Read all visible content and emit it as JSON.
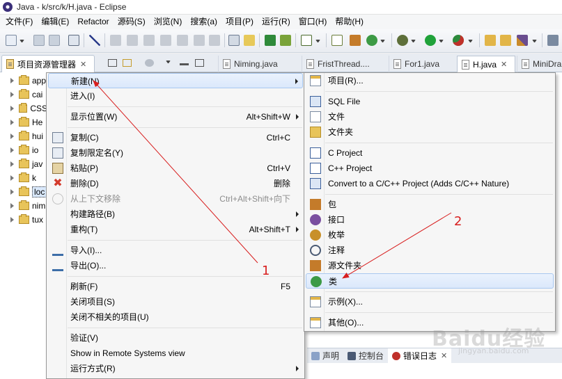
{
  "window": {
    "title": "Java - k/src/k/H.java - Eclipse"
  },
  "menubar": {
    "items": [
      "文件(F)",
      "编辑(E)",
      "Refactor",
      "源码(S)",
      "浏览(N)",
      "搜索(a)",
      "项目(P)",
      "运行(R)",
      "窗口(H)",
      "帮助(H)"
    ]
  },
  "tabs": {
    "explorer": {
      "label": "项目资源管理器",
      "close": "✕"
    },
    "editors": [
      {
        "label": "Niming.java"
      },
      {
        "label": "FristThread...."
      },
      {
        "label": "For1.java"
      },
      {
        "label": "H.java",
        "close": "✕"
      },
      {
        "label": "MiniDra"
      }
    ]
  },
  "explorer": {
    "items": [
      "app",
      "cai",
      "CSS",
      "He",
      "hui",
      "io",
      "jav",
      "k",
      "loc",
      "nim",
      "tux"
    ],
    "selected_index": 8
  },
  "context_menu": {
    "items": [
      {
        "label": "新建(N)",
        "accel": "",
        "submenu": true,
        "highlighted": true
      },
      {
        "label": "进入(I)",
        "accel": ""
      },
      {
        "label": "显示位置(W)",
        "accel": "Alt+Shift+W",
        "submenu": true
      },
      {
        "label": "复制(C)",
        "accel": "Ctrl+C",
        "icon": "copy-icon"
      },
      {
        "label": "复制限定名(Y)",
        "accel": "",
        "icon": "copy-qualified-icon"
      },
      {
        "label": "粘贴(P)",
        "accel": "Ctrl+V",
        "icon": "paste-icon"
      },
      {
        "label": "删除(D)",
        "accel": "删除",
        "icon": "delete-icon"
      },
      {
        "label": "从上下文移除",
        "accel": "Ctrl+Alt+Shift+向下",
        "disabled": true,
        "icon": "remove-context-icon"
      },
      {
        "label": "构建路径(B)",
        "accel": "",
        "submenu": true
      },
      {
        "label": "重构(T)",
        "accel": "Alt+Shift+T",
        "submenu": true
      },
      {
        "label": "导入(I)...",
        "accel": "",
        "icon": "import-icon"
      },
      {
        "label": "导出(O)...",
        "accel": "",
        "icon": "export-icon"
      },
      {
        "label": "刷新(F)",
        "accel": "F5"
      },
      {
        "label": "关闭项目(S)",
        "accel": ""
      },
      {
        "label": "关闭不相关的项目(U)",
        "accel": ""
      },
      {
        "label": "验证(V)",
        "accel": ""
      },
      {
        "label": "Show in Remote Systems view",
        "accel": ""
      },
      {
        "label": "运行方式(R)",
        "accel": "",
        "submenu": true
      }
    ]
  },
  "submenu": {
    "items": [
      {
        "label": "项目(R)...",
        "icon": "new-project-icon"
      },
      {
        "label": "SQL File",
        "icon": "sql-file-icon"
      },
      {
        "label": "文件",
        "icon": "new-file-icon"
      },
      {
        "label": "文件夹",
        "icon": "new-folder-icon"
      },
      {
        "label": "C Project",
        "icon": "c-project-icon"
      },
      {
        "label": "C++ Project",
        "icon": "cpp-project-icon"
      },
      {
        "label": "Convert to a C/C++ Project (Adds C/C++ Nature)",
        "icon": "convert-icon"
      },
      {
        "label": "包",
        "icon": "package-icon"
      },
      {
        "label": "接口",
        "icon": "interface-icon"
      },
      {
        "label": "枚举",
        "icon": "enum-icon"
      },
      {
        "label": "注释",
        "icon": "annotation-icon"
      },
      {
        "label": "源文件夹",
        "icon": "source-folder-icon"
      },
      {
        "label": "类",
        "icon": "class-icon",
        "highlighted": true
      },
      {
        "label": "示例(X)...",
        "icon": "example-icon"
      },
      {
        "label": "其他(O)...",
        "icon": "other-icon"
      }
    ]
  },
  "bottom_panel": {
    "tabs": [
      {
        "label": "声明"
      },
      {
        "label": "控制台"
      },
      {
        "label": "错误日志",
        "close": "✕",
        "active": true
      }
    ]
  },
  "annotations": {
    "first": "1",
    "second": "2"
  },
  "watermark": {
    "text": "Baidu经验",
    "sub": "jingyan.baidu.com"
  },
  "colors": {
    "highlight_border": "#a8c8f0",
    "annotation": "#d81e1e",
    "delete_red": "#d33a2c"
  }
}
